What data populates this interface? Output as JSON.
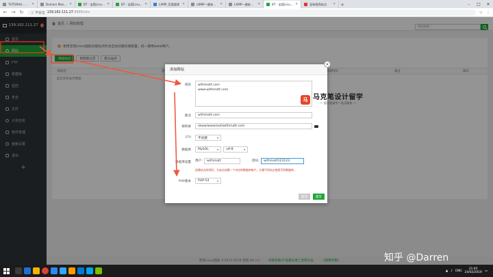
{
  "browser": {
    "tabs": [
      {
        "label": "TUTORIAL - Summary",
        "fav": "gray"
      },
      {
        "label": "Domain Manager",
        "fav": "gray"
      },
      {
        "label": "BT - 宝塔Linux面板安装教程",
        "fav": "green"
      },
      {
        "label": "BT - 宝塔Linux面板 - 7月4日",
        "fav": "green"
      },
      {
        "label": "LAMP_百度搜索",
        "fav": "blue"
      },
      {
        "label": "LNMP一键安装包",
        "fav": "gray"
      },
      {
        "label": "LAMP一键安装包 - Cen",
        "fav": "gray"
      },
      {
        "label": "BT - 宝塔Linux面板",
        "fav": "green",
        "active": true
      },
      {
        "label": "没有找到站点",
        "fav": "red"
      }
    ],
    "new_tab": "+",
    "window_controls": [
      "–",
      "□",
      "✕"
    ],
    "nav": [
      "←",
      "→",
      "↻"
    ],
    "security": "ⓘ 不安全",
    "host": "139.162.111.27",
    "path": ":8888/site",
    "right_icons": [
      "☆",
      "⋮"
    ]
  },
  "sidebar": {
    "server_ip": "139.162.111.27",
    "badge": "0",
    "items": [
      {
        "label": "首页"
      },
      {
        "label": "网站",
        "active": true
      },
      {
        "label": "FTP"
      },
      {
        "label": "数据库"
      },
      {
        "label": "监控"
      },
      {
        "label": "安全"
      },
      {
        "label": "文件"
      },
      {
        "label": "计划任务"
      },
      {
        "label": "软件管理"
      },
      {
        "label": "面板设置"
      },
      {
        "label": "退出"
      }
    ],
    "plus": "+"
  },
  "main": {
    "breadcrumb_home": "首页",
    "breadcrumb_sep": "/",
    "breadcrumb_current": "网站管理",
    "search_placeholder": "网站搜索",
    "tip": "使用宝塔Linux面板创建站点时会自动创建权限配置，统一使用www用户。",
    "tip_icon": "!",
    "toolbar": {
      "add_site": "添加站点",
      "default_page": "修改默认页",
      "default_site": "默认站点"
    },
    "table_headers": [
      "网站名",
      "状态",
      "备份",
      "根目录",
      "到期时间",
      "备注",
      "操作"
    ],
    "empty_text": "当前没有站点数据",
    "footer_copyright": "宝塔Linux面板 ©2014-2018 宝塔 (bt.cn)",
    "footer_help": "问题求助|产品建议请上宝塔论坛",
    "footer_manual": "《使用手册》"
  },
  "modal": {
    "title": "添加网站",
    "close": "×",
    "domain_label": "域名",
    "domain_lines": [
      "withmatt.com",
      "www.withmatt.com"
    ],
    "remark_label": "备注",
    "remark_value": "withmatt.com",
    "root_label": "根目录",
    "root_value": "/www/wwwroot/withmatt.com",
    "ftp_label": "FTP",
    "ftp_value": "不创建",
    "db_label": "数据库",
    "db_type": "MySQL",
    "db_charset": "utf-8",
    "dbset_label": "数据库设置",
    "user_label": "用户:",
    "user_value": "withmatt",
    "pass_label": "密码:",
    "pass_value": "withmatt123123",
    "db_note": "创建站点的同时，为站点创建一个对应的数据库帐户，方便不同站点使用不同数据库。",
    "php_label": "PHP版本",
    "php_value": "PHP-54",
    "cancel": "取消",
    "submit": "提交"
  },
  "logo_watermark": {
    "mark": "马",
    "name": "马克笔设计留学",
    "slogan": "一 设计类留学一站式服务 一"
  },
  "site_watermark": "知乎 @Darren",
  "taskbar": {
    "lang": "ENG",
    "time": "21:45",
    "date": "24/02/2019"
  },
  "colors": {
    "accent": "#20a53a",
    "arrow": "#f0583f",
    "sidebar": "#2f3438"
  }
}
